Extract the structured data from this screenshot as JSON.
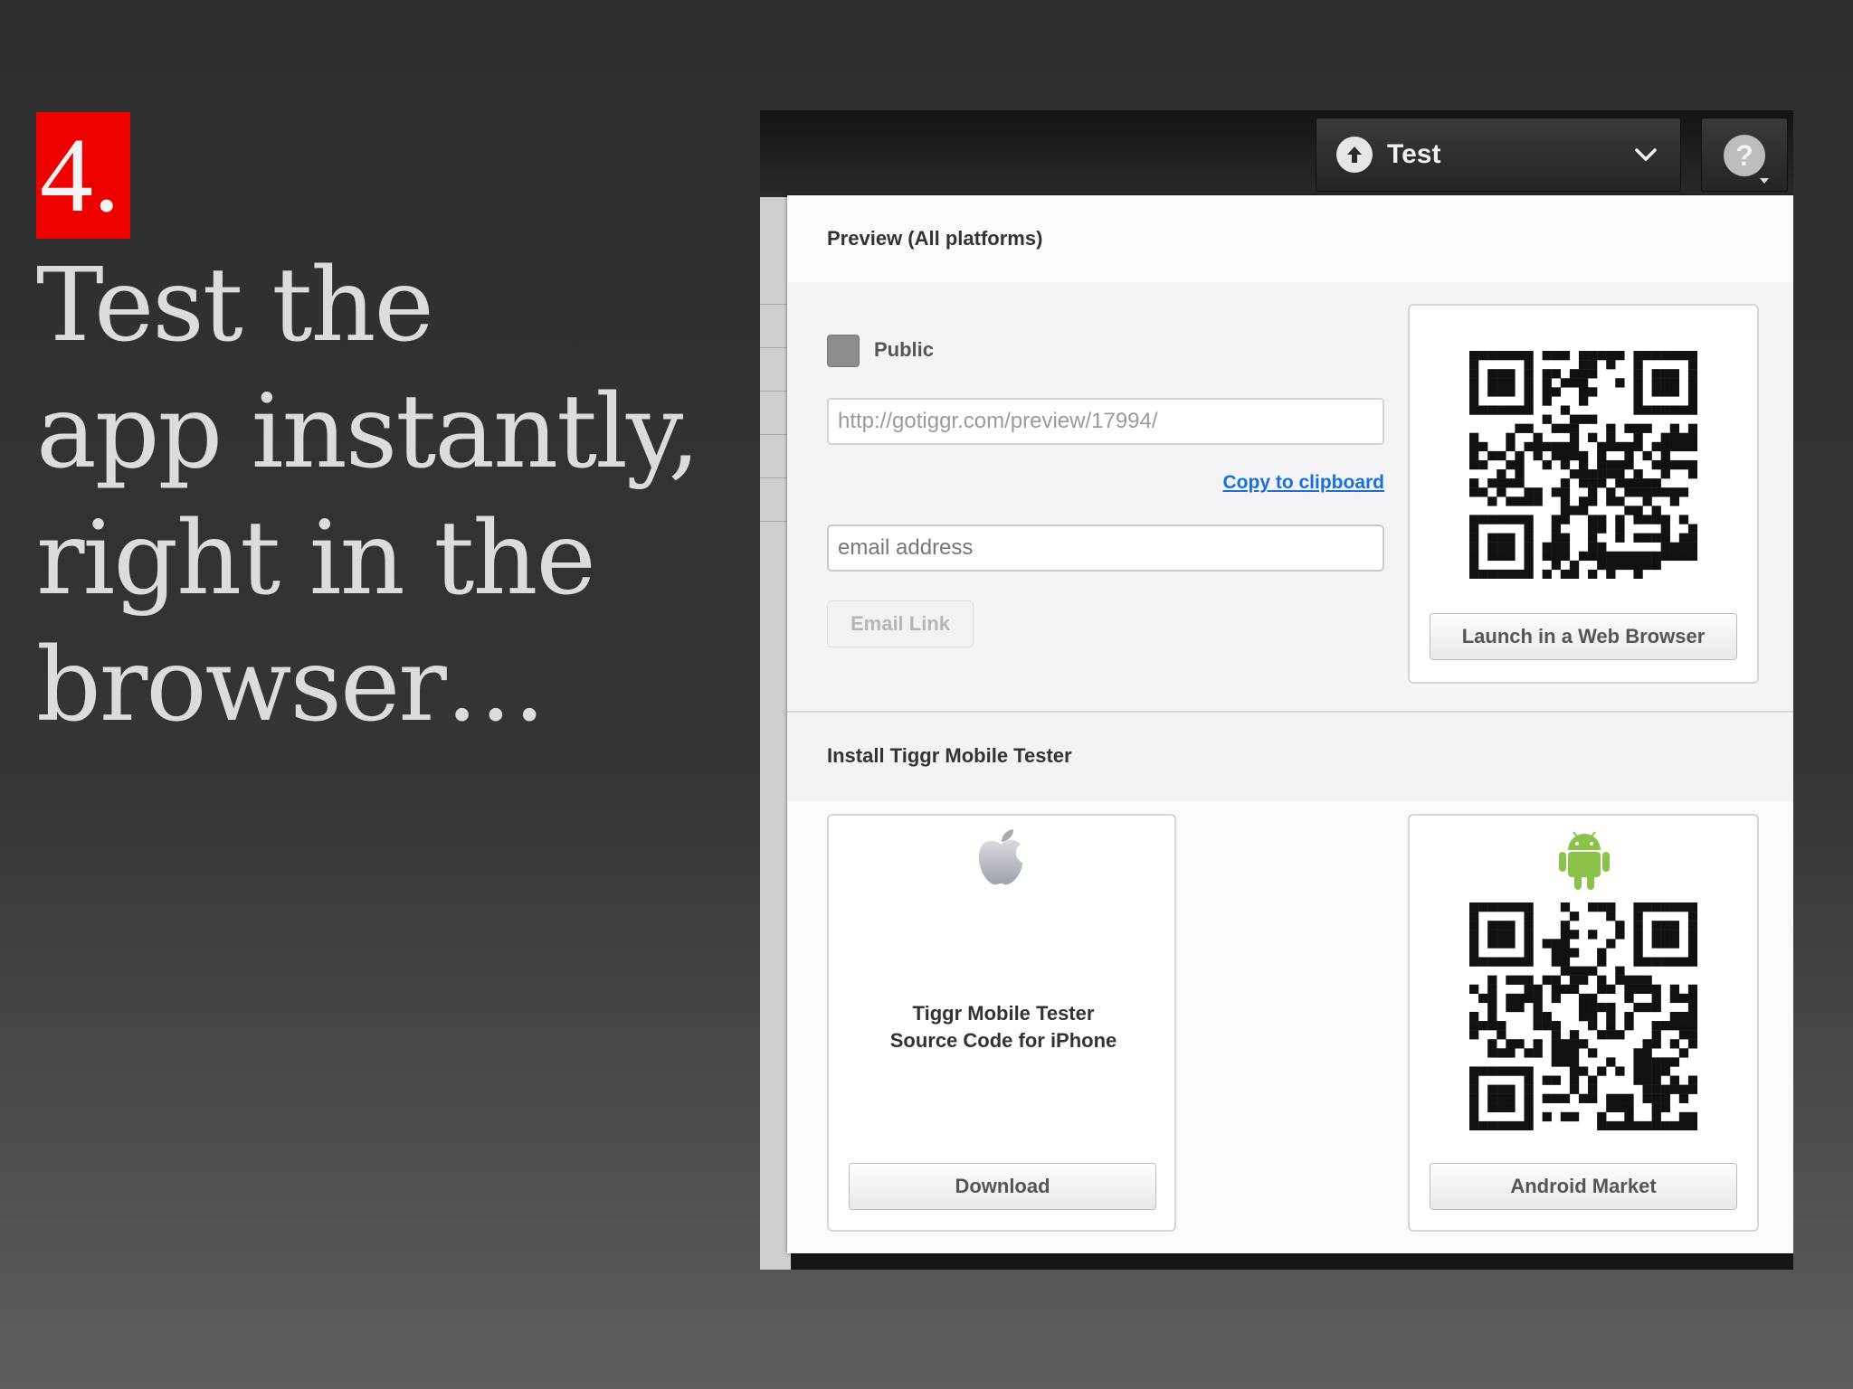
{
  "slide": {
    "step_number": "4.",
    "headline": "Test the\napp instantly,\nright in the\nbrowser…"
  },
  "toolbar": {
    "test_label": "Test",
    "help_glyph": "?"
  },
  "preview": {
    "heading": "Preview (All platforms)",
    "public_label": "Public",
    "url_value": "http://gotiggr.com/preview/17994/",
    "copy_link": "Copy to clipboard",
    "email_placeholder": "email address",
    "email_button": "Email Link",
    "launch_button": "Launch in a Web Browser"
  },
  "install": {
    "heading": "Install Tiggr Mobile Tester",
    "ios_line1": "Tiggr Mobile Tester",
    "ios_line2": "Source Code for iPhone",
    "download_button": "Download",
    "android_button": "Android Market"
  },
  "colors": {
    "badge_red": "#ee0000",
    "link_blue": "#1a6fe0",
    "android_green": "#8bc34a"
  },
  "icons": [
    "upload-icon",
    "chevron-down-icon",
    "help-icon",
    "apple-icon",
    "android-icon",
    "qr-code"
  ]
}
